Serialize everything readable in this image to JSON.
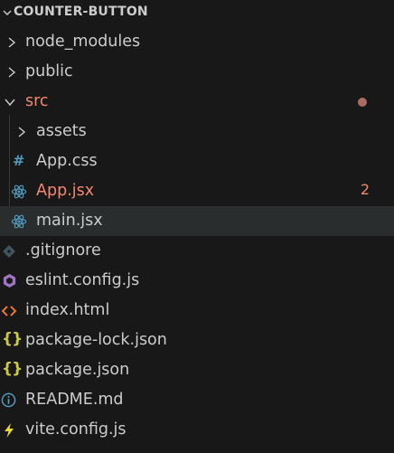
{
  "explorer": {
    "folder_title": "COUNTER-BUTTON",
    "items": [
      {
        "label": "node_modules",
        "icon": "chevron-right-icon"
      },
      {
        "label": "public",
        "icon": "chevron-right-icon"
      },
      {
        "label": "src",
        "icon": "chevron-down-icon",
        "modified_dot": true
      },
      {
        "label": "assets",
        "icon": "chevron-right-icon"
      },
      {
        "label": "App.css",
        "icon": "css-hash-icon"
      },
      {
        "label": "App.jsx",
        "icon": "react-icon",
        "problems": "2"
      },
      {
        "label": "main.jsx",
        "icon": "react-icon"
      },
      {
        "label": ".gitignore",
        "icon": "git-diamond-icon"
      },
      {
        "label": "eslint.config.js",
        "icon": "eslint-icon"
      },
      {
        "label": "index.html",
        "icon": "html-code-icon"
      },
      {
        "label": "package-lock.json",
        "icon": "json-braces-icon"
      },
      {
        "label": "package.json",
        "icon": "json-braces-icon"
      },
      {
        "label": "README.md",
        "icon": "info-icon"
      },
      {
        "label": "vite.config.js",
        "icon": "vite-bolt-icon"
      }
    ]
  },
  "colors": {
    "background": "#181818",
    "text": "#cccccc",
    "error": "#f48771",
    "react": "#519aba",
    "css": "#519aba",
    "json": "#cbcb41",
    "html": "#e37933",
    "eslint": "#a074c4",
    "vite": "#e9d93a",
    "git": "#41535b",
    "selected_row": "#2a2d2e"
  }
}
